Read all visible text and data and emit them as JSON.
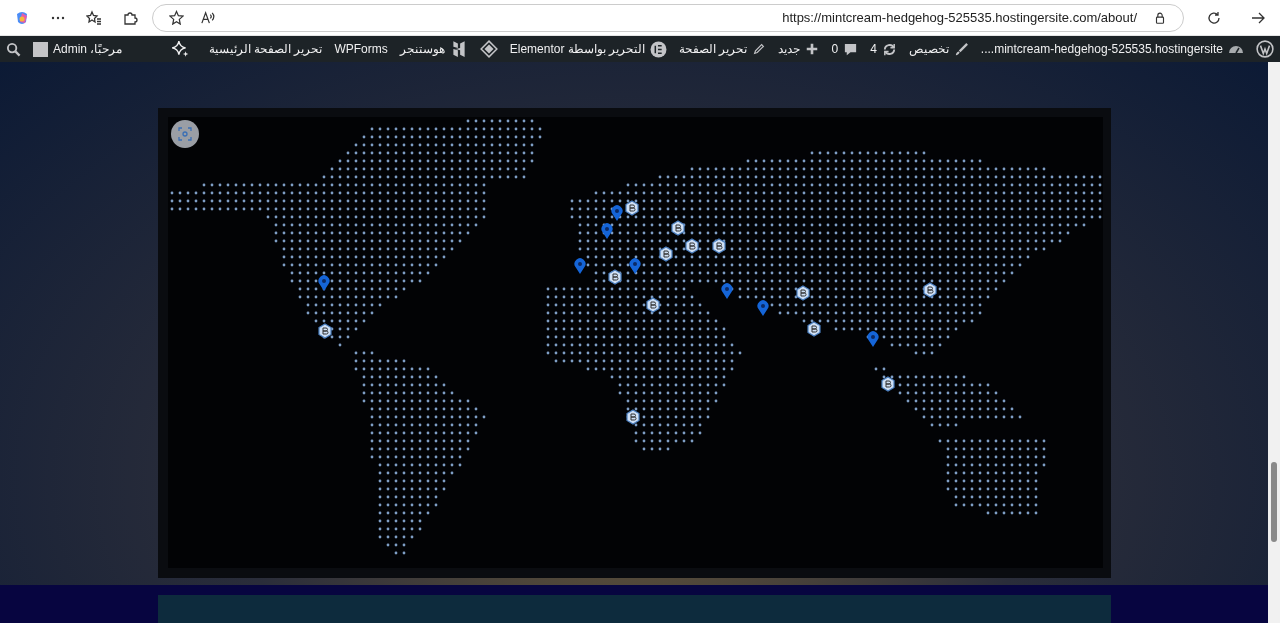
{
  "browser": {
    "url": "https://mintcream-hedgehog-525535.hostingersite.com/about/"
  },
  "admin_bar": {
    "right_items": [
      {
        "kind": "logo"
      },
      {
        "kind": "site",
        "label": "....mintcream-hedgehog-525535.hostingersite"
      },
      {
        "kind": "brush",
        "label": "تخصيص"
      },
      {
        "kind": "updates",
        "label": "4"
      },
      {
        "kind": "comments",
        "label": "0"
      },
      {
        "kind": "plus",
        "label": "جديد"
      },
      {
        "kind": "pencil",
        "label": "تحرير الصفحة"
      },
      {
        "kind": "elementor",
        "label": "التحرير بواسطة Elementor"
      },
      {
        "kind": "diamond"
      },
      {
        "kind": "hostinger",
        "label": "هوستنجر"
      },
      {
        "kind": "text",
        "label": "WPForms"
      },
      {
        "kind": "text",
        "label": "تحرير الصفحة الرئيسية"
      },
      {
        "kind": "sparkle"
      }
    ],
    "greeting": "مرحبًا، Admin"
  }
}
